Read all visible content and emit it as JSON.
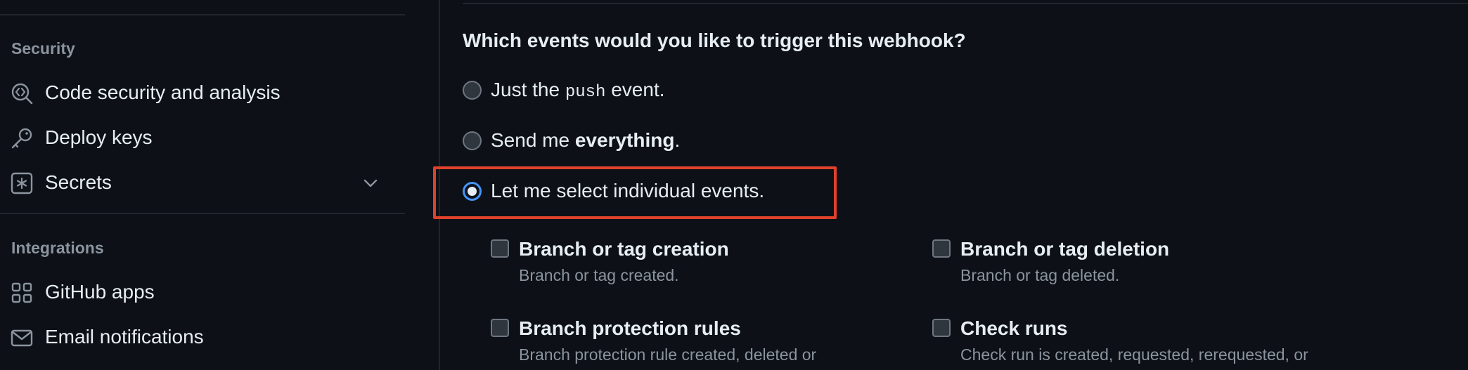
{
  "sidebar": {
    "security_heading": "Security",
    "integrations_heading": "Integrations",
    "items": [
      {
        "label": "Code security and analysis",
        "icon": "code-scan-icon"
      },
      {
        "label": "Deploy keys",
        "icon": "key-icon"
      },
      {
        "label": "Secrets",
        "icon": "asterisk-box-icon"
      },
      {
        "label": "GitHub apps",
        "icon": "apps-grid-icon"
      },
      {
        "label": "Email notifications",
        "icon": "mail-icon"
      }
    ]
  },
  "main": {
    "question": "Which events would you like to trigger this webhook?",
    "radio_options": {
      "push": {
        "prefix": "Just the ",
        "code": "push",
        "suffix": " event."
      },
      "everything": {
        "prefix": "Send me ",
        "bold": "everything",
        "suffix": "."
      },
      "individual": {
        "label": "Let me select individual events."
      }
    },
    "selected_option": "individual",
    "highlight_color": "#e0412b",
    "events": [
      {
        "title": "Branch or tag creation",
        "desc": "Branch or tag created."
      },
      {
        "title": "Branch or tag deletion",
        "desc": "Branch or tag deleted."
      },
      {
        "title": "Branch protection rules",
        "desc": "Branch protection rule created, deleted or"
      },
      {
        "title": "Check runs",
        "desc": "Check run is created, requested, rerequested, or"
      }
    ]
  },
  "colors": {
    "background": "#0d1117",
    "text": "#e6edf3",
    "muted": "#8b949e",
    "accent": "#4493f8"
  }
}
